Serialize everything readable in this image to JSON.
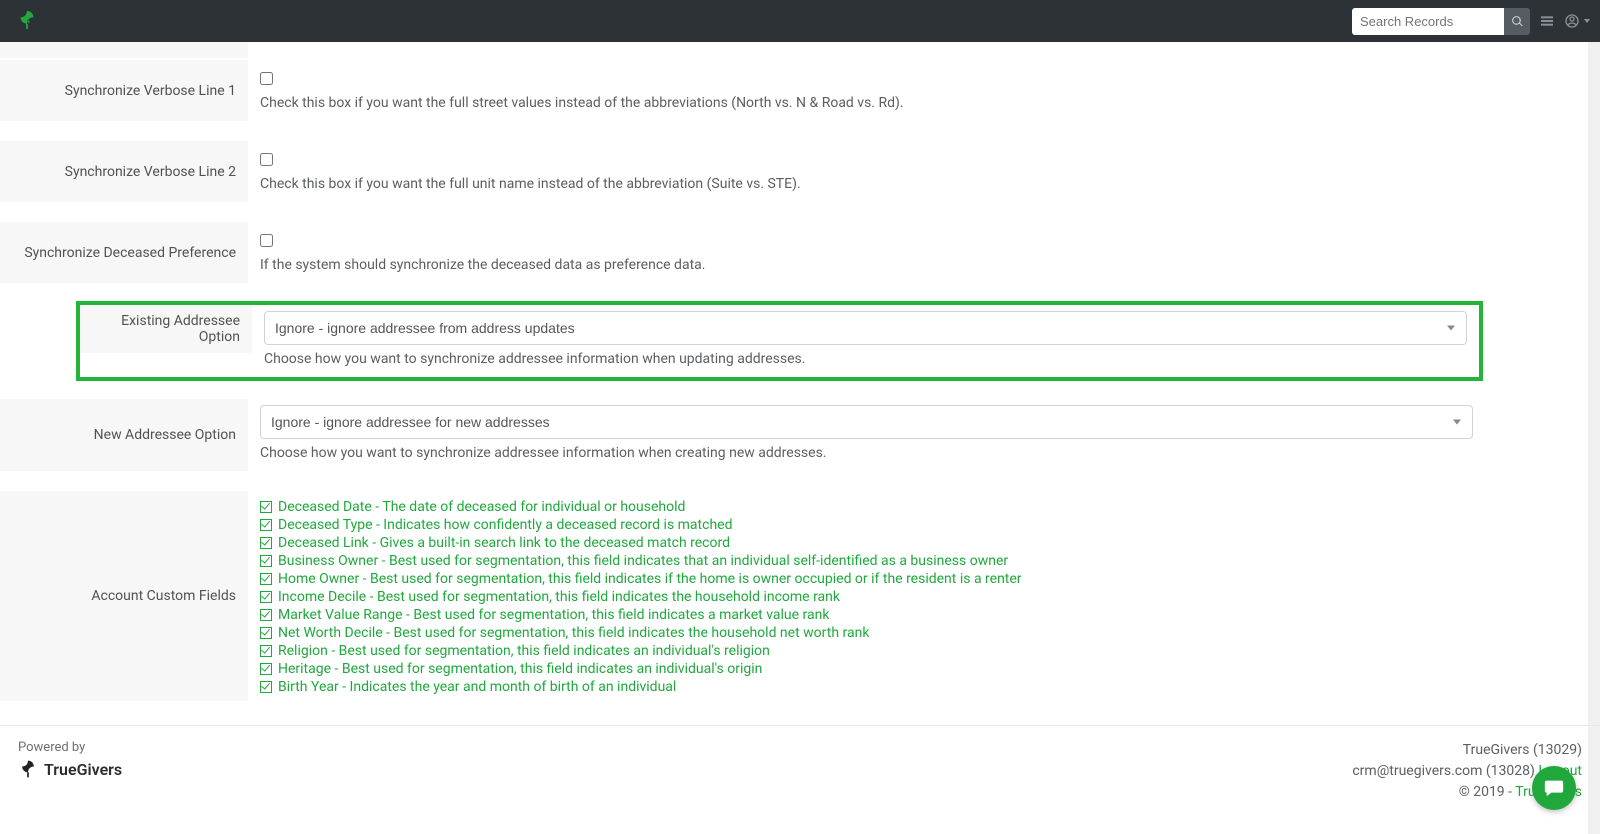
{
  "nav": {
    "search_placeholder": "Search Records"
  },
  "rows": {
    "verbose1": {
      "label": "Synchronize Verbose Line 1",
      "help": "Check this box if you want the full street values instead of the abbreviations (North vs. N & Road vs. Rd)."
    },
    "verbose2": {
      "label": "Synchronize Verbose Line 2",
      "help": "Check this box if you want the full unit name instead of the abbreviation (Suite vs. STE)."
    },
    "deceased_pref": {
      "label": "Synchronize Deceased Preference",
      "help": "If the system should synchronize the deceased data as preference data."
    },
    "existing_addressee": {
      "label": "Existing Addressee Option",
      "value": "Ignore - ignore addressee from address updates",
      "help": "Choose how you want to synchronize addressee information when updating addresses."
    },
    "new_addressee": {
      "label": "New Addressee Option",
      "value": "Ignore - ignore addressee for new addresses",
      "help": "Choose how you want to synchronize addressee information when creating new addresses."
    },
    "custom_fields": {
      "label": "Account Custom Fields",
      "items": [
        "Deceased Date - The date of deceased for individual or household",
        "Deceased Type - Indicates how confidently a deceased record is matched",
        "Deceased Link - Gives a built-in search link to the deceased match record",
        "Business Owner - Best used for segmentation, this field indicates that an individual self-identified as a business owner",
        "Home Owner - Best used for segmentation, this field indicates if the home is owner occupied or if the resident is a renter",
        "Income Decile - Best used for segmentation, this field indicates the household income rank",
        "Market Value Range - Best used for segmentation, this field indicates a market value rank",
        "Net Worth Decile - Best used for segmentation, this field indicates the household net worth rank",
        "Religion - Best used for segmentation, this field indicates an individual's religion",
        "Heritage - Best used for segmentation, this field indicates an individual's origin",
        "Birth Year - Indicates the year and month of birth of an individual"
      ]
    }
  },
  "footer": {
    "powered_by": "Powered by",
    "brand": "TrueGivers",
    "org": "TrueGivers (13029)",
    "user": "crm@truegivers.com (13028) ",
    "logout": "Logout",
    "copyright": "© 2019 - ",
    "copyright_link": "TrueGivers"
  }
}
